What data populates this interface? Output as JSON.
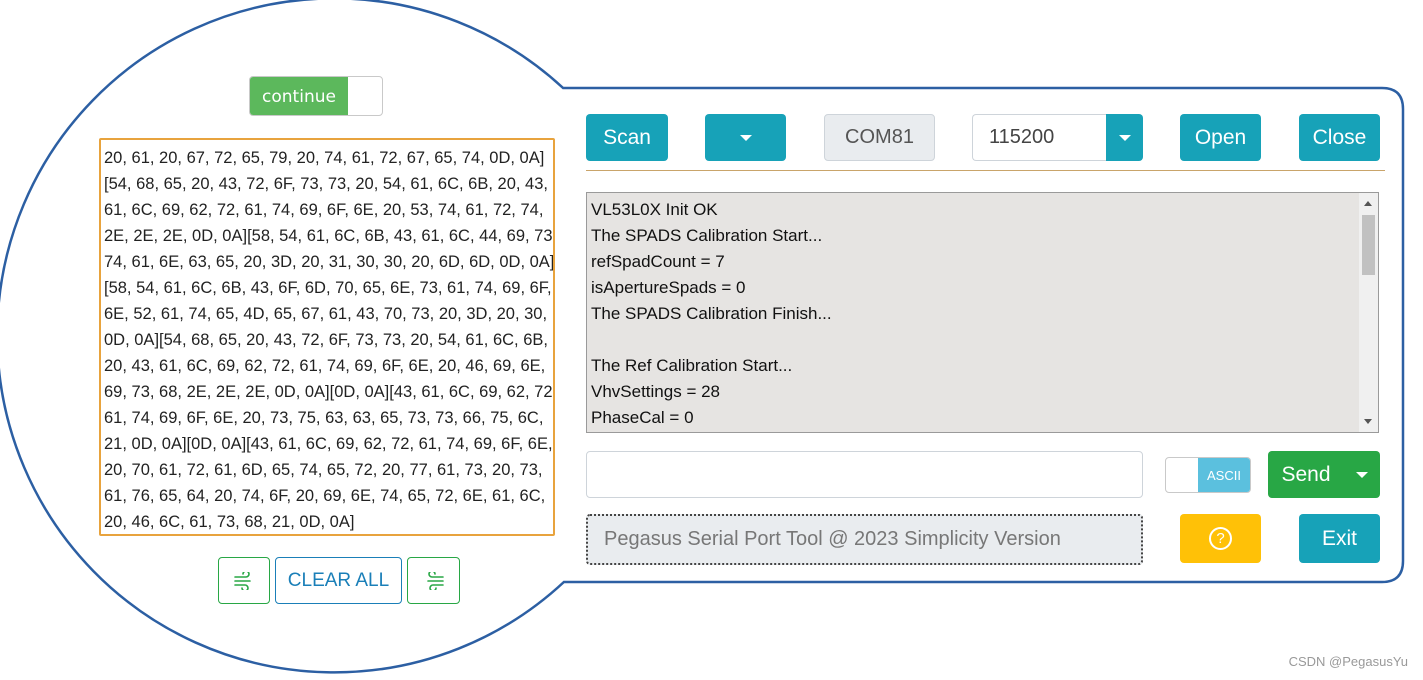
{
  "left_panel": {
    "continue_label": "continue",
    "hex_lines": [
      "20, 61, 20, 67, 72, 65, 79, 20, 74, 61, 72, 67, 65, 74, 0D, 0A]",
      "[54, 68, 65, 20, 43, 72, 6F, 73, 73, 20, 54, 61, 6C, 6B, 20, 43,",
      "61, 6C, 69, 62, 72, 61, 74, 69, 6F, 6E, 20, 53, 74, 61, 72, 74,",
      "2E, 2E, 2E, 0D, 0A][58, 54, 61, 6C, 6B, 43, 61, 6C, 44, 69, 73,",
      "74, 61, 6E, 63, 65, 20, 3D, 20, 31, 30, 30, 20, 6D, 6D, 0D, 0A]",
      "[58, 54, 61, 6C, 6B, 43, 6F, 6D, 70, 65, 6E, 73, 61, 74, 69, 6F,",
      "6E, 52, 61, 74, 65, 4D, 65, 67, 61, 43, 70, 73, 20, 3D, 20, 30,",
      "0D, 0A][54, 68, 65, 20, 43, 72, 6F, 73, 73, 20, 54, 61, 6C, 6B,",
      "20, 43, 61, 6C, 69, 62, 72, 61, 74, 69, 6F, 6E, 20, 46, 69, 6E,",
      "69, 73, 68, 2E, 2E, 2E, 0D, 0A][0D, 0A][43, 61, 6C, 69, 62, 72,",
      "61, 74, 69, 6F, 6E, 20, 73, 75, 63, 63, 65, 73, 73, 66, 75, 6C,",
      "21, 0D, 0A][0D, 0A][43, 61, 6C, 69, 62, 72, 61, 74, 69, 6F, 6E,",
      "20, 70, 61, 72, 61, 6D, 65, 74, 65, 72, 20, 77, 61, 73, 20, 73,",
      "61, 76, 65, 64, 20, 74, 6F, 20, 69, 6E, 74, 65, 72, 6E, 61, 6C,",
      "20, 46, 6C, 61, 73, 68, 21, 0D, 0A]"
    ],
    "clear_all_label": "CLEAR ALL",
    "icons": {
      "left": "wind-icon",
      "right": "wind-reverse-icon"
    }
  },
  "toolbar": {
    "scan_label": "Scan",
    "port_value": "COM81",
    "baud_value": "115200",
    "open_label": "Open",
    "close_label": "Close"
  },
  "log": {
    "lines": [
      "VL53L0X Init OK",
      "The SPADS Calibration Start...",
      "refSpadCount = 7",
      "isApertureSpads = 0",
      "The SPADS Calibration Finish...",
      "",
      "The Ref Calibration Start...",
      "VhvSettings = 28",
      "PhaseCal = 0"
    ]
  },
  "send_row": {
    "input_value": "",
    "ascii_label": "ASCII",
    "send_label": "Send"
  },
  "footer": {
    "status_text": "Pegasus Serial Port Tool @ 2023 Simplicity Version",
    "help_label": "?",
    "exit_label": "Exit"
  },
  "watermark": "CSDN @PegasusYu",
  "colors": {
    "frame_outline": "#2c5fa3",
    "teal": "#17a2b8",
    "green": "#28a745",
    "toggle_green": "#5cb85c",
    "ascii_blue": "#5bc0de",
    "help_yellow": "#ffc107",
    "hex_border": "#e8a33d",
    "log_bg": "#e6e4e2"
  }
}
